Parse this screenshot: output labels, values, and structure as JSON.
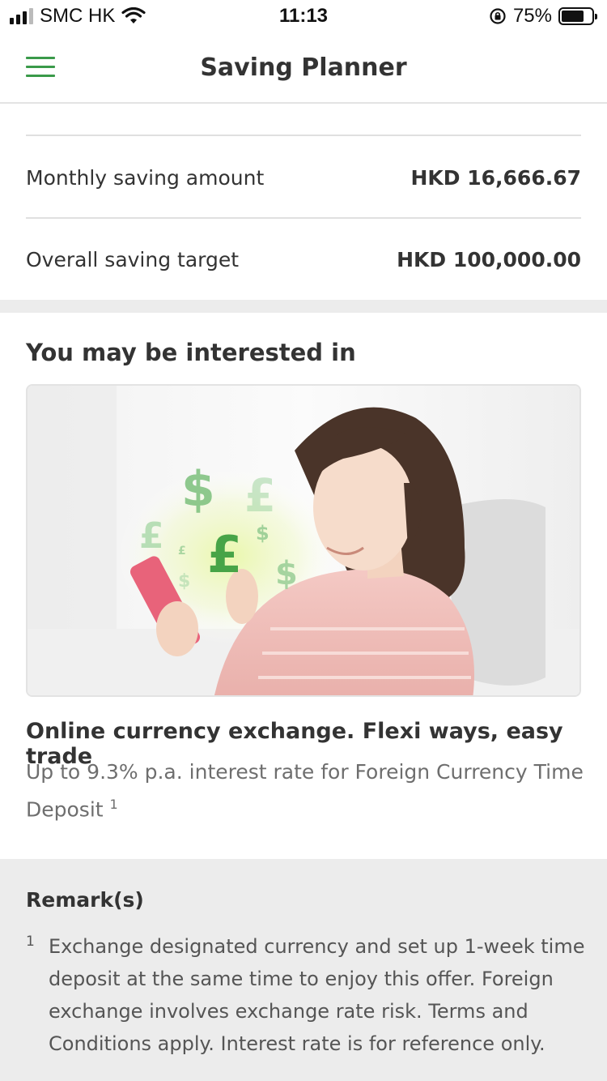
{
  "status_bar": {
    "carrier": "SMC HK",
    "time": "11:13",
    "battery_percent": "75%",
    "battery_level": 0.75
  },
  "header": {
    "title": "Saving Planner"
  },
  "summary": {
    "rows": [
      {
        "label": "Monthly saving amount",
        "value": "HKD 16,666.67"
      },
      {
        "label": "Overall saving target",
        "value": "HKD 100,000.00"
      }
    ]
  },
  "promo": {
    "section_title": "You may be interested in",
    "card_title": "Online currency exchange. Flexi ways, easy trade",
    "card_desc": "Up to 9.3% p.a. interest rate for Foreign Currency Time Deposit",
    "card_desc_footnote": "1",
    "image_symbols": [
      "$",
      "£",
      "£",
      "$",
      "£",
      "$",
      "£",
      "$"
    ]
  },
  "remarks": {
    "title": "Remark(s)",
    "items": [
      {
        "num": "1",
        "text": "Exchange designated currency and set up 1-week time deposit at the same time to enjoy this offer. Foreign exchange involves exchange rate risk. Terms and Conditions apply. Interest rate is for reference only."
      }
    ]
  },
  "colors": {
    "accent_green": "#3a9a4a",
    "section_gap": "#ececec"
  },
  "icons": {
    "menu": "hamburger-menu-icon",
    "wifi": "wifi-icon",
    "signal": "cellular-signal-icon",
    "rotation_lock": "rotation-lock-icon",
    "battery": "battery-icon"
  }
}
